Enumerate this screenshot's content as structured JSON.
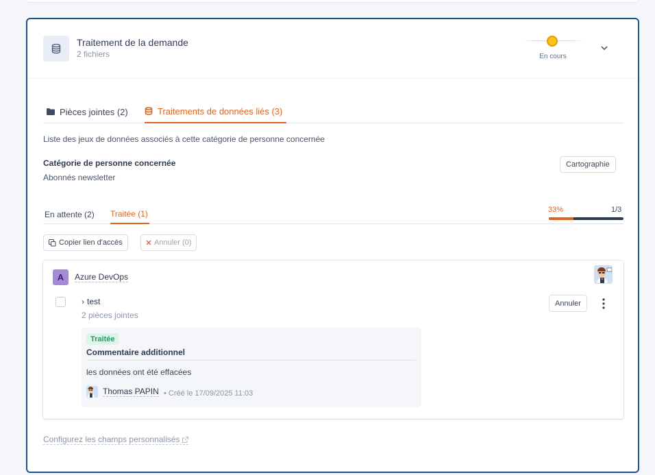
{
  "card": {
    "title": "Traitement de la demande",
    "subtitle": "2 fichiers",
    "status": "En cours",
    "status_color": "#f8c41a"
  },
  "tabs": [
    {
      "label": "Pièces jointes (2)",
      "active": false,
      "icon": "folder-icon"
    },
    {
      "label": "Traitements de données liés (3)",
      "active": true,
      "icon": "database-icon"
    }
  ],
  "description": "Liste des jeux de données associés à cette catégorie de personne concernée",
  "category": {
    "label": "Catégorie de personne concernée",
    "value": "Abonnés newsletter",
    "button": "Cartographie"
  },
  "subtabs": [
    {
      "label": "En attente (2)",
      "active": false
    },
    {
      "label": "Traitée (1)",
      "active": true
    }
  ],
  "progress": {
    "percent_label": "33%",
    "fraction_label": "1/3",
    "value": 0.33
  },
  "actions": {
    "copy": "Copier lien d'accès",
    "cancel": "Annuler (0)"
  },
  "item": {
    "avatar_letter": "A",
    "name": "Azure DevOps",
    "row_name": "test",
    "row_sub": "2 pièces jointes",
    "cancel_button": "Annuler",
    "comment": {
      "badge": "Traitée",
      "title": "Commentaire additionnel",
      "text": "les données ont été effacées",
      "author": "Thomas PAPIN",
      "date": "• Créé le 17/09/2025 11:03"
    }
  },
  "config_link": "Configurez les champs personnalisés",
  "colors": {
    "accent": "#e0651b",
    "border_active": "#1f4f8a",
    "success": "#23996b"
  }
}
